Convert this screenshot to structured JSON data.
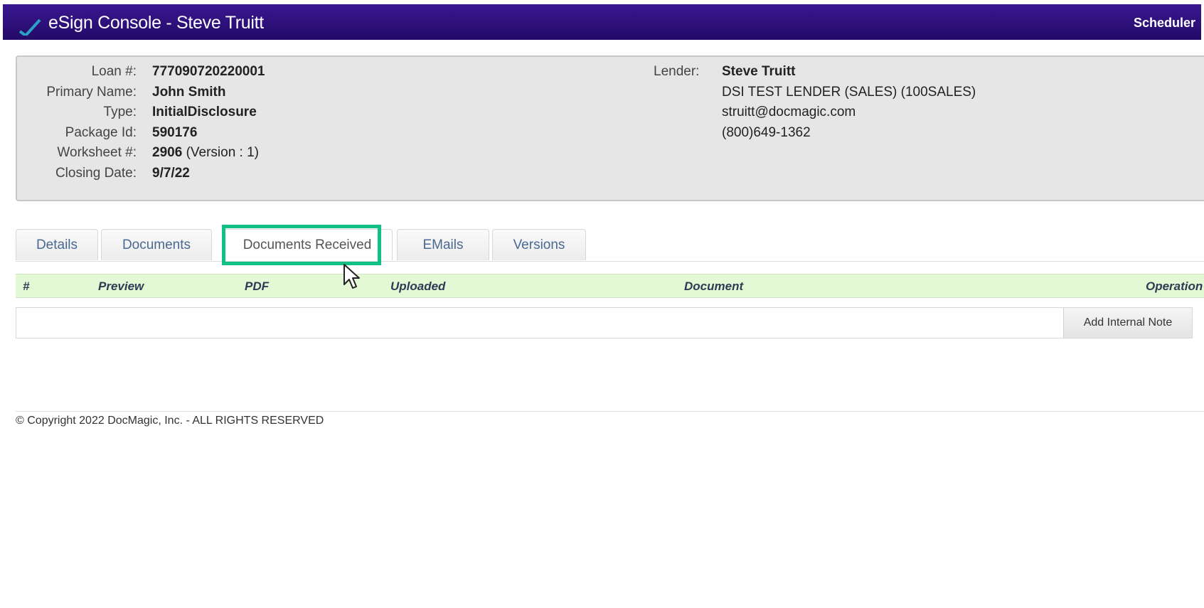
{
  "header": {
    "title": "eSign Console - Steve Truitt",
    "right_link": "Scheduler"
  },
  "loan_info": {
    "fields": [
      {
        "label": "Loan #:",
        "value": "777090720220001"
      },
      {
        "label": "Primary Name:",
        "value": "John Smith"
      },
      {
        "label": "Type:",
        "value": "InitialDisclosure"
      },
      {
        "label": "Package Id:",
        "value": "590176"
      },
      {
        "label": "Worksheet #:",
        "value": "2906",
        "suffix": "(Version : 1)"
      },
      {
        "label": "Closing Date:",
        "value": "9/7/22"
      }
    ],
    "lender": {
      "label": "Lender:",
      "name": "Steve Truitt",
      "company": "DSI TEST LENDER (SALES) (100SALES)",
      "email": "struitt@docmagic.com",
      "phone": "(800)649-1362"
    }
  },
  "tabs": [
    {
      "label": "Details"
    },
    {
      "label": "Documents"
    },
    {
      "label": "Documents Received",
      "active": true
    },
    {
      "label": "EMails"
    },
    {
      "label": "Versions"
    }
  ],
  "table": {
    "columns": [
      "#",
      "Preview",
      "PDF",
      "Uploaded",
      "Document",
      "Operation"
    ]
  },
  "actions": {
    "add_internal_note": "Add Internal Note"
  },
  "footer": {
    "copyright": "© Copyright 2022 DocMagic, Inc. - ALL RIGHTS RESERVED"
  },
  "colors": {
    "titlebar": "#2d1079",
    "highlight": "#12bf86",
    "grid_header": "#e3f8d4",
    "tab_text": "#4a6890"
  }
}
